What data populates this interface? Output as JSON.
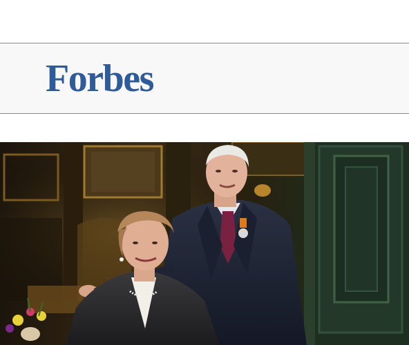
{
  "header": {
    "logo_text": "Forbes",
    "logo_color": "#2f5b99"
  },
  "photo": {
    "subject": "portrait-photo"
  }
}
